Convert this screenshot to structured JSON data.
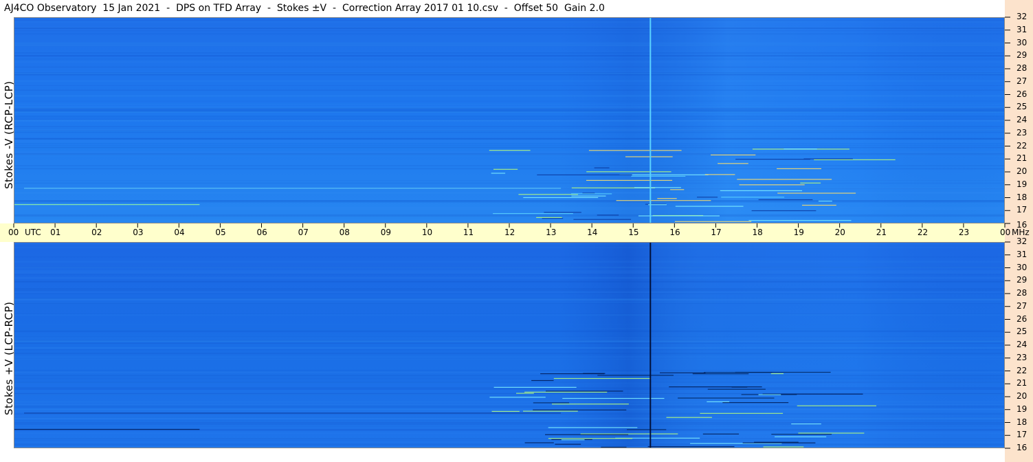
{
  "title": "AJ4CO Observatory  15 Jan 2021  -  DPS on TFD Array  -  Stokes ±V  -  Correction Array 2017 01 10.csv  -  Offset 50  Gain 2.0",
  "colors": {
    "background": "#1a6ee6",
    "time_band": "#ffffcc",
    "freq_strip": "#fce3cc"
  },
  "chart_data": [
    {
      "type": "heatmap",
      "panel": "top",
      "ylabel": "Stokes -V (RCP-LCP)",
      "x_ticks": [
        "00",
        "01",
        "02",
        "03",
        "04",
        "05",
        "06",
        "07",
        "08",
        "09",
        "10",
        "11",
        "12",
        "13",
        "14",
        "15",
        "16",
        "17",
        "18",
        "19",
        "20",
        "21",
        "22",
        "23",
        "00"
      ],
      "x_unit": "UTC",
      "y_ticks": [
        32,
        31,
        30,
        29,
        28,
        27,
        26,
        25,
        24,
        23,
        22,
        21,
        20,
        19,
        18,
        17,
        16
      ],
      "y_unit": "MHz",
      "xlim": [
        0,
        24
      ],
      "ylim": [
        16,
        32
      ],
      "vertical_line_utc": 15.4,
      "vertical_line_color": "#5ad2ff"
    },
    {
      "type": "heatmap",
      "panel": "bottom",
      "ylabel": "Stokes +V (LCP-RCP)",
      "x_ticks": [
        "00",
        "01",
        "02",
        "03",
        "04",
        "05",
        "06",
        "07",
        "08",
        "09",
        "10",
        "11",
        "12",
        "13",
        "14",
        "15",
        "16",
        "17",
        "18",
        "19",
        "20",
        "21",
        "22",
        "23",
        "00"
      ],
      "x_unit": "UTC",
      "y_ticks": [
        32,
        31,
        30,
        29,
        28,
        27,
        26,
        25,
        24,
        23,
        22,
        21,
        20,
        19,
        18,
        17,
        16
      ],
      "y_unit": "MHz",
      "xlim": [
        0,
        24
      ],
      "ylim": [
        16,
        32
      ],
      "vertical_line_utc": 15.4,
      "vertical_line_color": "#00103a"
    }
  ],
  "axis_text": {
    "utc": "UTC",
    "mhz": "MHz"
  }
}
